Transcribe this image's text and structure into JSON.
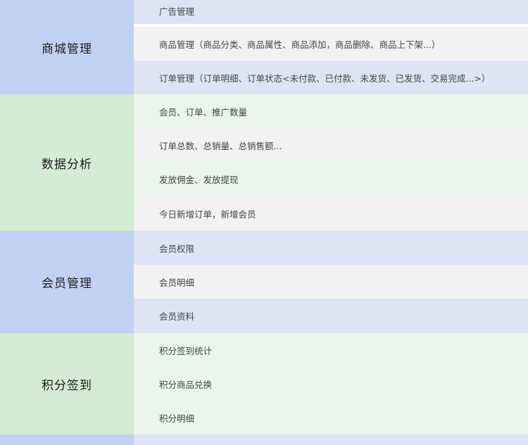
{
  "groups": [
    {
      "category": "商城管理",
      "items": [
        "广告管理",
        "商品管理（商品分类、商品属性、商品添加，商品删除、商品上下架...）",
        "订单管理（订单明细、订单状态<未付款、已付款、未发货、已发货、交易完成...>）"
      ]
    },
    {
      "category": "数据分析",
      "items": [
        "会员、订单、推广数量",
        "订单总数、总销量、总销售额...",
        "发放佣金、发放提现",
        "今日新增订单，新增会员"
      ]
    },
    {
      "category": "会员管理",
      "items": [
        "会员权限",
        "会员明细",
        "会员资料"
      ]
    },
    {
      "category": "积分签到",
      "items": [
        "积分签到统计",
        "积分商品兑换",
        "积分明细"
      ]
    }
  ],
  "colors": {
    "blue_category": "#c1d1f3",
    "blue_row": "#dfe4f5",
    "green_category": "#d3ecd3",
    "green_row": "#ebf5eb",
    "neutral_row": "#f2f2f2"
  }
}
